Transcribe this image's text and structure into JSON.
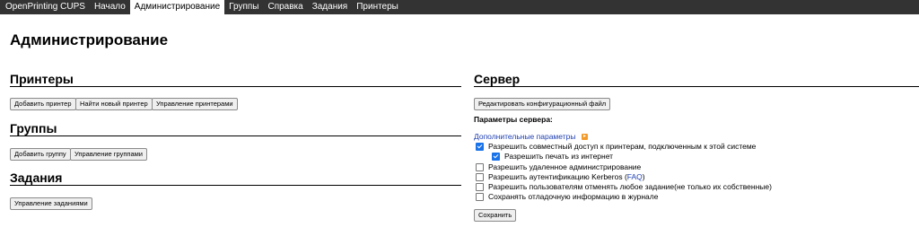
{
  "nav": {
    "items": [
      {
        "label": "OpenPrinting CUPS",
        "active": false
      },
      {
        "label": "Начало",
        "active": false
      },
      {
        "label": "Администрирование",
        "active": true
      },
      {
        "label": "Группы",
        "active": false
      },
      {
        "label": "Справка",
        "active": false
      },
      {
        "label": "Задания",
        "active": false
      },
      {
        "label": "Принтеры",
        "active": false
      }
    ]
  },
  "page": {
    "title": "Администрирование"
  },
  "printers": {
    "title": "Принтеры",
    "add_label": "Добавить принтер",
    "find_label": "Найти новый принтер",
    "manage_label": "Управление принтерами"
  },
  "groups": {
    "title": "Группы",
    "add_label": "Добавить группу",
    "manage_label": "Управление группами"
  },
  "jobs": {
    "title": "Задания",
    "manage_label": "Управление заданиями"
  },
  "server": {
    "title": "Сервер",
    "edit_config_label": "Редактировать конфигурационный файл",
    "settings_label": "Параметры сервера:",
    "advanced_link": "Дополнительные параметры",
    "options": [
      {
        "label": "Разрешить совместный доступ к принтерам, подключенным к этой системе",
        "checked": true
      },
      {
        "label": "Разрешить печать из интернет",
        "checked": true
      },
      {
        "label": "Разрешить удаленное администрирование",
        "checked": false
      },
      {
        "label": "Разрешить аутентификацию Kerberos (",
        "link": "FAQ",
        "suffix": ")",
        "checked": false
      },
      {
        "label": "Разрешить пользователям отменять любое задание(не только их собственные)",
        "checked": false
      },
      {
        "label": "Сохранять отладочную информацию в журнале",
        "checked": false
      }
    ],
    "save_label": "Сохранить"
  },
  "colors": {
    "nav_bg": "#333333",
    "link": "#1f3fb0",
    "checkbox_checked": "#1a73e8",
    "rss": "#f39a2a"
  },
  "icons": {
    "rss": "rss-icon"
  }
}
